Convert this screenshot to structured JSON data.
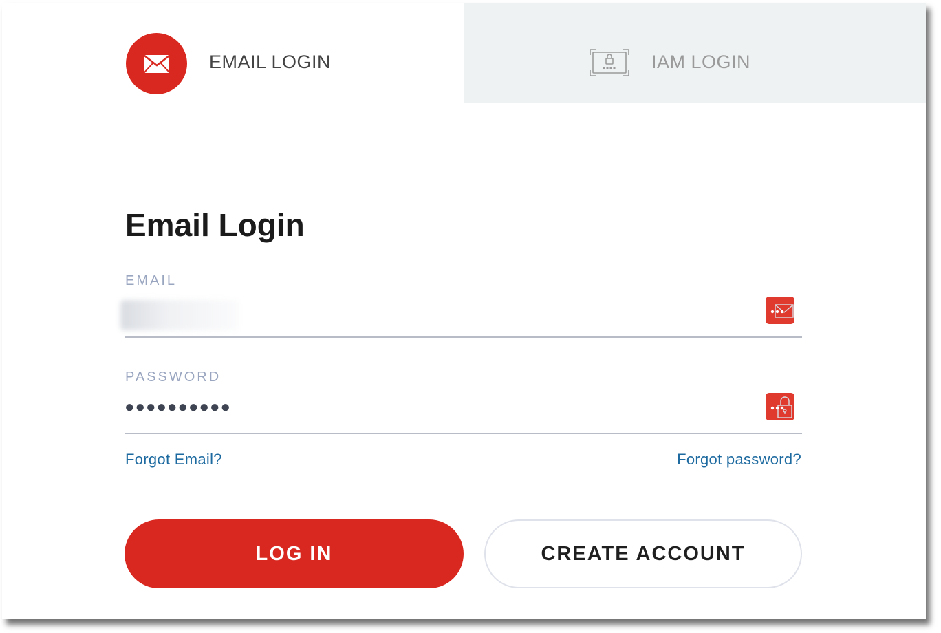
{
  "tabs": {
    "email": {
      "label": "EMAIL LOGIN",
      "icon": "envelope-icon",
      "active": true
    },
    "iam": {
      "label": "IAM LOGIN",
      "icon": "keypad-lock-icon",
      "active": false
    }
  },
  "form": {
    "title": "Email Login",
    "email": {
      "label": "EMAIL",
      "value": "",
      "placeholder": "",
      "manager_icon": "password-manager-icon"
    },
    "password": {
      "label": "PASSWORD",
      "masked_value": "●●●●●●●●●●",
      "manager_icon": "password-manager-icon"
    },
    "forgot_email": "Forgot Email?",
    "forgot_password": "Forgot password?",
    "login_button": "LOG IN",
    "create_account_button": "CREATE ACCOUNT"
  },
  "colors": {
    "brand_red": "#d9281f",
    "link_blue": "#1d6aa0",
    "label_gray": "#9aa6c0",
    "inactive_tab_bg": "#eff2f3"
  }
}
